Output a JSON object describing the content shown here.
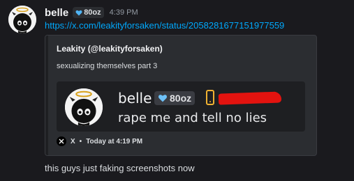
{
  "message": {
    "author": "belle",
    "tag": "80oz",
    "timestamp": "4:39 PM",
    "link": "https://x.com/leakityforsaken/status/2058281677151977559",
    "body": "this guys just faking screenshots now"
  },
  "embed": {
    "author": "Leakity (@leakityforsaken)",
    "description": "sexualizing themselves part 3",
    "image": {
      "name": "belle",
      "tag": "80oz",
      "text": "rape me and tell no lies"
    },
    "footer": {
      "source": "X",
      "separator": "•",
      "time": "Today at 4:19 PM"
    }
  },
  "colors": {
    "background": "#1a1a1e",
    "embed_background": "#2b2d31",
    "link": "#00a8fc",
    "redaction": "#e3130f",
    "phone_icon": "#f0b232"
  },
  "icons": [
    "avatar-character",
    "heart-badge-icon",
    "phone-icon",
    "x-logo-icon"
  ]
}
